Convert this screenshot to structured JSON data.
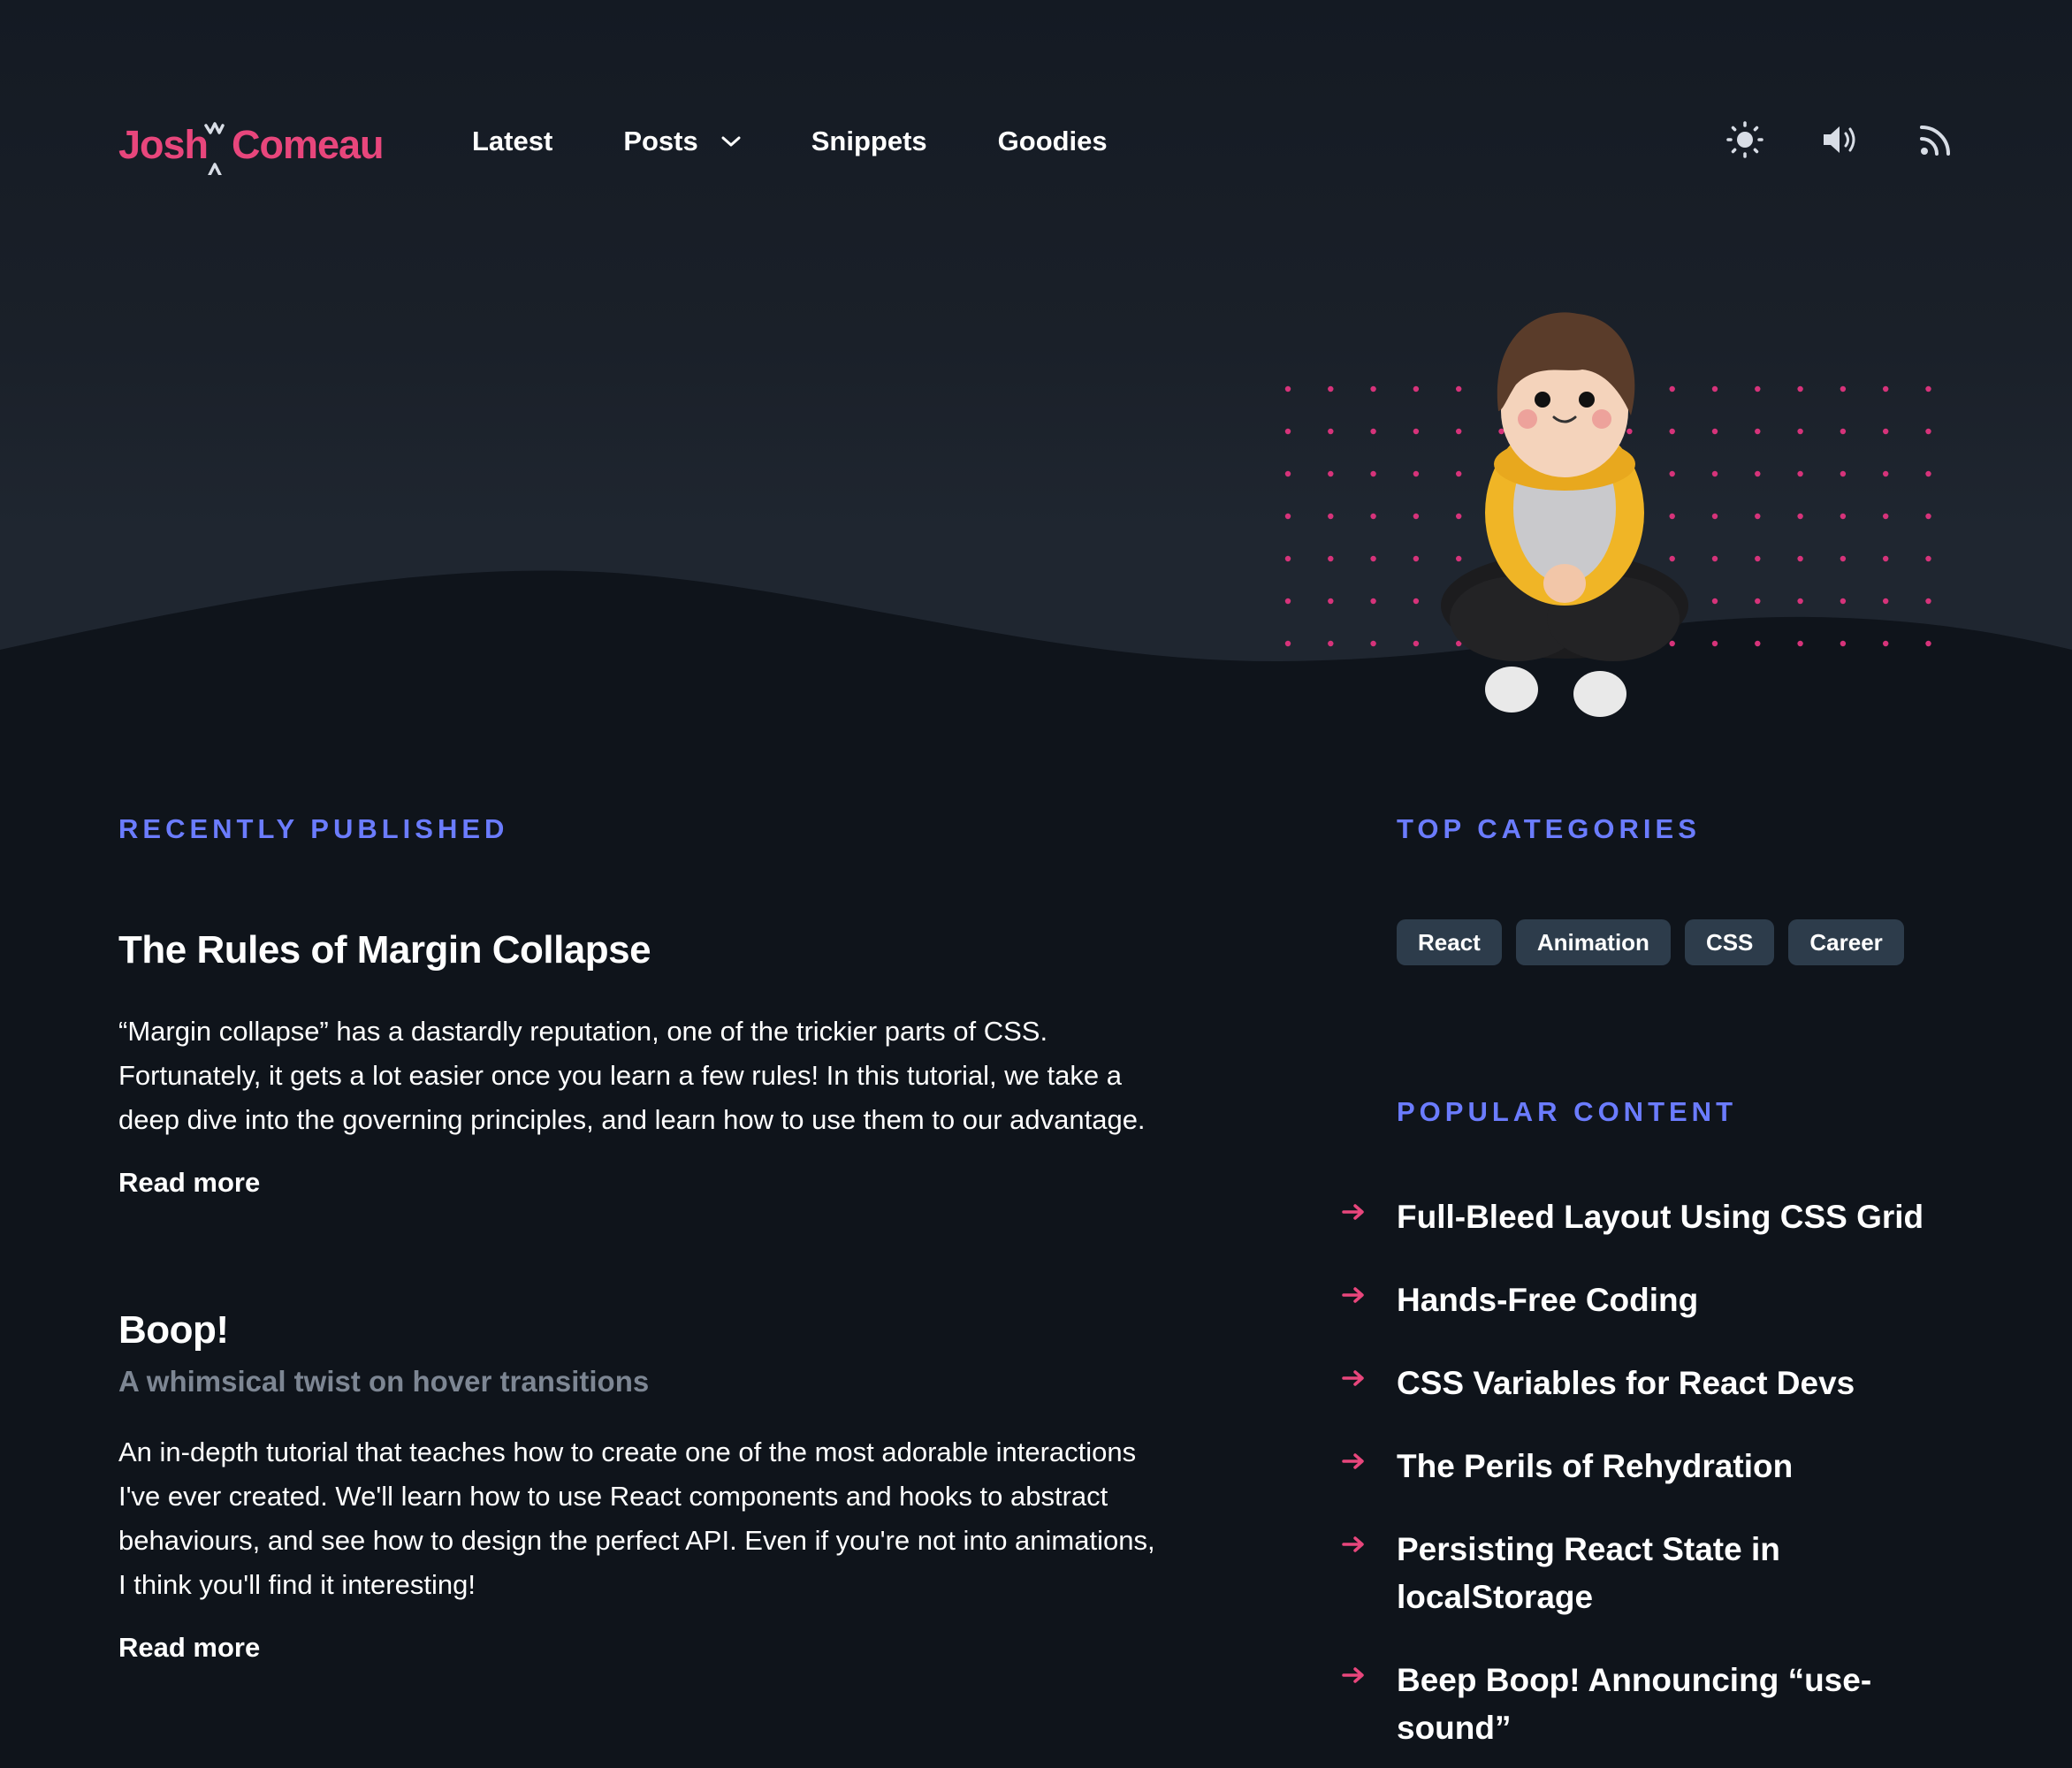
{
  "brand": {
    "first": "Josh",
    "last": "Comeau",
    "color": "#e8467c"
  },
  "nav": {
    "items": [
      {
        "label": "Latest"
      },
      {
        "label": "Posts",
        "icon": "chevron-down-icon"
      },
      {
        "label": "Snippets"
      },
      {
        "label": "Goodies"
      }
    ]
  },
  "header_icons": [
    "sun-icon",
    "volume-icon",
    "rss-icon"
  ],
  "recent": {
    "label": "Recently Published",
    "posts": [
      {
        "title": "The Rules of Margin Collapse",
        "excerpt_lines": [
          "“Margin collapse” has a dastardly reputation, one of the trickier parts of CSS.",
          "Fortunately, it gets a lot easier once you learn a few rules! In this tutorial, we take a",
          "deep dive into the governing principles, and learn how to use them to our advantage."
        ],
        "read_more": "Read more"
      },
      {
        "title": "Boop!",
        "subtitle": "A whimsical twist on hover transitions",
        "excerpt_lines": [
          "An in-depth tutorial that teaches how to create one of the most adorable interactions",
          "I've ever created. We'll learn how to use React components and hooks to abstract",
          "behaviours, and see how to design the perfect API. Even if you're not into animations,",
          "I think you'll find it interesting!"
        ],
        "read_more": "Read more"
      }
    ]
  },
  "categories": {
    "label": "Top Categories",
    "items": [
      "React",
      "Animation",
      "CSS",
      "Career"
    ]
  },
  "popular": {
    "label": "Popular Content",
    "items": [
      {
        "lines": [
          "Full-Bleed Layout Using CSS Grid"
        ]
      },
      {
        "lines": [
          "Hands-Free Coding"
        ]
      },
      {
        "lines": [
          "CSS Variables for React Devs"
        ]
      },
      {
        "lines": [
          "The Perils of Rehydration"
        ]
      },
      {
        "lines": [
          "Persisting React State in",
          "localStorage"
        ]
      },
      {
        "lines": [
          "Beep Boop! Announcing “use-",
          "sound”"
        ]
      }
    ]
  },
  "colors": {
    "accent_blue": "#6b7cff",
    "accent_pink": "#e8467c",
    "chip_bg": "#2d3c4b",
    "page_bg": "#0f141b"
  }
}
